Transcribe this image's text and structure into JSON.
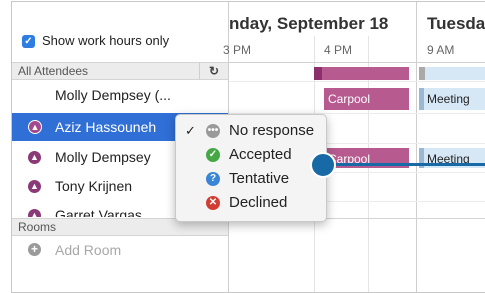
{
  "work_hours": {
    "label": "Show work hours only",
    "checked": true
  },
  "attendees": {
    "header": "All Attendees",
    "refresh_icon": "refresh-icon",
    "rows": [
      {
        "name": "Molly Dempsey (...",
        "status": "organizer"
      },
      {
        "name": "Aziz Hassouneh",
        "status": "no-response",
        "selected": true
      },
      {
        "name": "Molly Dempsey",
        "status": "no-response"
      },
      {
        "name": "Tony Krijnen",
        "status": "no-response"
      },
      {
        "name": "Garret Vargas",
        "status": "no-response"
      }
    ]
  },
  "rooms": {
    "header": "Rooms",
    "add_label": "Add Room"
  },
  "calendar": {
    "day1_title": "nday, September 18",
    "day2_title": "Tuesda",
    "time_labels": [
      "3 PM",
      "4 PM",
      "9 AM"
    ],
    "events": {
      "carpool": "Carpool",
      "meeting": "Meeting"
    }
  },
  "status_menu": {
    "items": [
      {
        "label": "No response",
        "checked": true,
        "icon": "ellipsis-icon",
        "color": "#9a9a9a"
      },
      {
        "label": "Accepted",
        "checked": false,
        "icon": "checkmark-icon",
        "color": "#45a845"
      },
      {
        "label": "Tentative",
        "checked": false,
        "icon": "question-icon",
        "color": "#3a85d6"
      },
      {
        "label": "Declined",
        "checked": false,
        "icon": "x-icon",
        "color": "#d23d33"
      }
    ]
  },
  "colors": {
    "selection": "#2f6fd6",
    "event_magenta": "#b65a8f",
    "event_blue": "#d6e7f6",
    "callout": "#176aa6"
  }
}
